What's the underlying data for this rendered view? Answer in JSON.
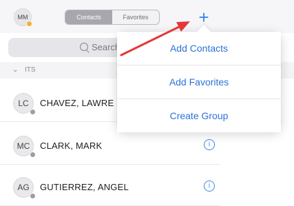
{
  "me": {
    "initials": "MM",
    "presence_color": "#f2b233"
  },
  "tabs": [
    {
      "label": "Contacts",
      "active": true
    },
    {
      "label": "Favorites",
      "active": false
    }
  ],
  "add_button_icon": "plus-icon",
  "search": {
    "placeholder": "Search"
  },
  "section": {
    "title": "ITS",
    "icon": "chevron-down-icon"
  },
  "contacts": [
    {
      "initials": "LC",
      "name": "CHAVEZ, LAWRE"
    },
    {
      "initials": "MC",
      "name": "CLARK, MARK"
    },
    {
      "initials": "AG",
      "name": "GUTIERREZ, ANGEL"
    }
  ],
  "menu": {
    "items": [
      {
        "label": "Add Contacts"
      },
      {
        "label": "Add Favorites"
      },
      {
        "label": "Create Group"
      }
    ]
  },
  "colors": {
    "accent": "#3a86e8",
    "link": "#2b72d8",
    "annotation_arrow": "#e3383a"
  }
}
